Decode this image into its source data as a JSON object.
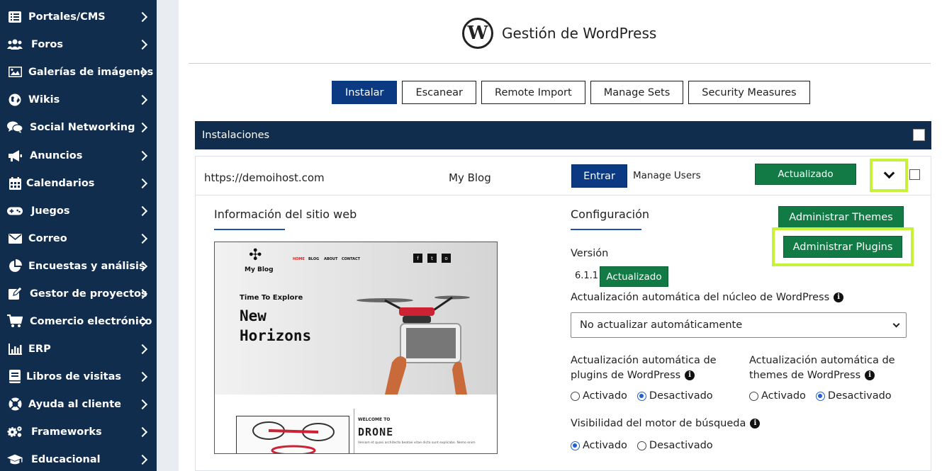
{
  "sidebar": {
    "items": [
      {
        "label": "Portales/CMS",
        "icon": "list-icon"
      },
      {
        "label": "Foros",
        "icon": "users-icon"
      },
      {
        "label": "Galerías de imágenes",
        "icon": "image-icon"
      },
      {
        "label": "Wikis",
        "icon": "globe-icon"
      },
      {
        "label": "Social Networking",
        "icon": "chat-icon"
      },
      {
        "label": "Anuncios",
        "icon": "megaphone-icon"
      },
      {
        "label": "Calendarios",
        "icon": "calendar-icon"
      },
      {
        "label": "Juegos",
        "icon": "gamepad-icon"
      },
      {
        "label": "Correo",
        "icon": "envelope-icon"
      },
      {
        "label": "Encuestas y análisis",
        "icon": "pie-chart-icon"
      },
      {
        "label": "Gestor de proyectos",
        "icon": "edit-icon"
      },
      {
        "label": "Comercio electrónico",
        "icon": "cart-icon"
      },
      {
        "label": "ERP",
        "icon": "bar-chart-icon"
      },
      {
        "label": "Libros de visitas",
        "icon": "book-icon"
      },
      {
        "label": "Ayuda al cliente",
        "icon": "lifebuoy-icon"
      },
      {
        "label": "Frameworks",
        "icon": "cogs-icon"
      },
      {
        "label": "Educacional",
        "icon": "graduation-cap-icon"
      }
    ]
  },
  "header": {
    "title": "Gestión de WordPress",
    "logo_letter": "W"
  },
  "tabs": [
    "Instalar",
    "Escanear",
    "Remote Import",
    "Manage Sets",
    "Security Measures"
  ],
  "installations": {
    "title": "Instalaciones",
    "row": {
      "url": "https://demoihost.com",
      "blog_name": "My Blog",
      "enter_label": "Entrar",
      "manage_users": "Manage Users",
      "status": "Actualizado"
    }
  },
  "site_info": {
    "title": "Información del sitio web",
    "preview": {
      "blog_title": "My Blog",
      "nav": [
        "HOME",
        "BLOG",
        "ABOUT",
        "CONTACT"
      ],
      "social": [
        "f",
        "t",
        "o"
      ],
      "tagline": "Time To Explore",
      "headline_1": "New",
      "headline_2": "Horizons",
      "welcome": "WELCOME TO",
      "drone": "DRONE",
      "body": "Veniam et quasi architecto beatae vitae dicta sunt explicabo. Nemo enim"
    }
  },
  "config": {
    "title": "Configuración",
    "manage_themes": "Administrar Themes",
    "manage_plugins": "Administrar Plugins",
    "version_label": "Versión",
    "version": "6.1.1",
    "version_status": "Actualizado",
    "auto_core_label": "Actualización automática del núcleo de WordPress",
    "auto_core_value": "No actualizar automáticamente",
    "auto_plugins_label_1": "Actualización automática de",
    "auto_plugins_label_2": "plugins de WordPress",
    "auto_themes_label_1": "Actualización automática de",
    "auto_themes_label_2": "themes de WordPress",
    "activated": "Activado",
    "deactivated": "Desactivado",
    "search_vis_label": "Visibilidad del motor de búsqueda"
  }
}
